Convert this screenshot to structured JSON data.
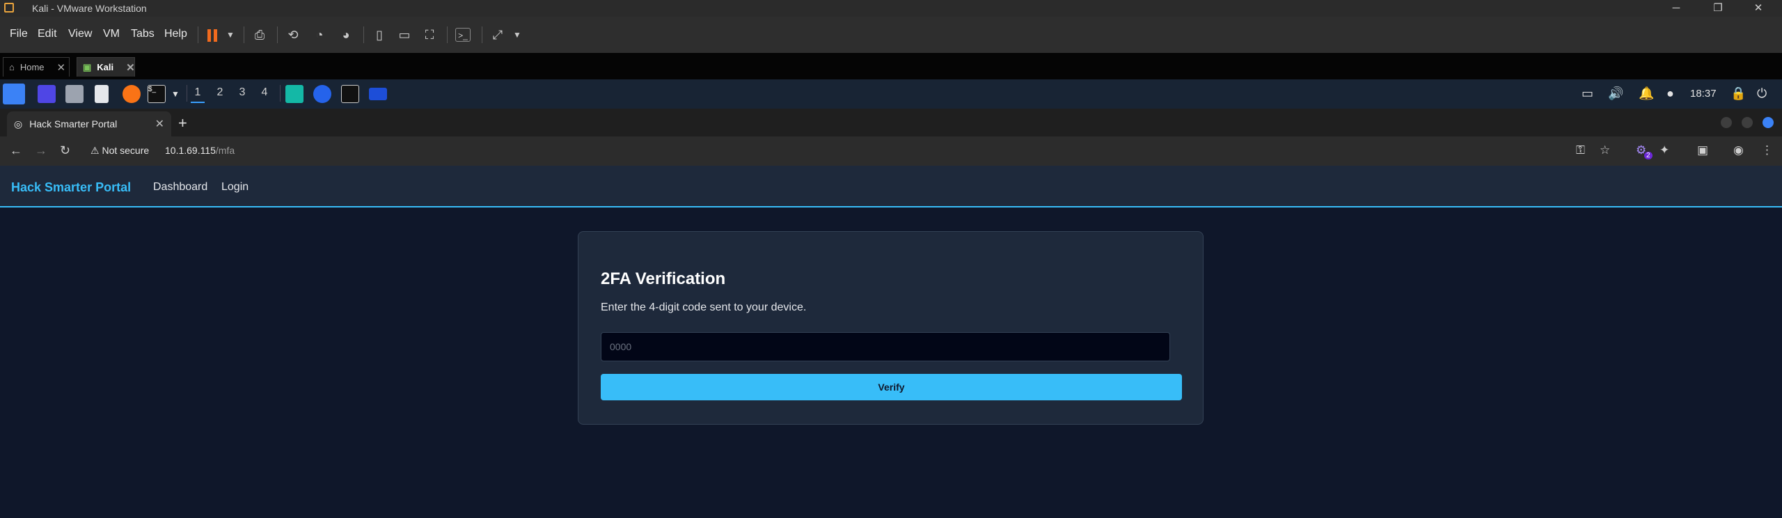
{
  "window": {
    "title": "Kali - VMware Workstation"
  },
  "menubar": {
    "items": [
      "File",
      "Edit",
      "View",
      "VM",
      "Tabs",
      "Help"
    ]
  },
  "vm_tabs": [
    {
      "label": "Home"
    },
    {
      "label": "Kali"
    }
  ],
  "kali_panel": {
    "workspaces": [
      "1",
      "2",
      "3",
      "4"
    ],
    "clock": "18:37"
  },
  "browser": {
    "tab_title": "Hack Smarter Portal",
    "security_label": "Not secure",
    "url_host": "10.1.69.115",
    "url_path": "/mfa",
    "extension_badge": "2"
  },
  "site": {
    "brand": "Hack Smarter Portal",
    "nav": [
      "Dashboard",
      "Login"
    ],
    "card": {
      "heading": "2FA Verification",
      "description": "Enter the 4-digit code sent to your device.",
      "input_placeholder": "0000",
      "button_label": "Verify"
    }
  },
  "colors": {
    "accent": "#38bdf8",
    "page_bg": "#0f172a",
    "card_bg": "#1e293b",
    "pause_icon": "#f06a1e"
  }
}
